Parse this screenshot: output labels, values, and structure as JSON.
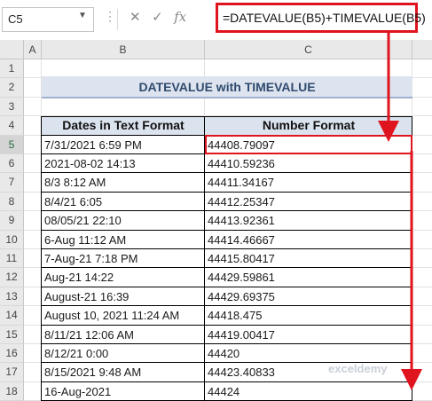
{
  "formula_bar": {
    "name_box": "C5",
    "formula": "=DATEVALUE(B5)+TIMEVALUE(B5)"
  },
  "columns": [
    "A",
    "B",
    "C"
  ],
  "rows": [
    "1",
    "2",
    "3",
    "4",
    "5",
    "6",
    "7",
    "8",
    "9",
    "10",
    "11",
    "12",
    "13",
    "14",
    "15",
    "16",
    "17",
    "18"
  ],
  "sheet": {
    "title": "DATEVALUE with TIMEVALUE",
    "headers": [
      "Dates in Text Format",
      "Number Format"
    ],
    "data": [
      [
        "7/31/2021 6:59 PM",
        "44408.79097"
      ],
      [
        "2021-08-02 14:13",
        "44410.59236"
      ],
      [
        "8/3 8:12 AM",
        "44411.34167"
      ],
      [
        "8/4/21 6:05",
        "44412.25347"
      ],
      [
        "08/05/21 22:10",
        "44413.92361"
      ],
      [
        "6-Aug 11:12 AM",
        "44414.46667"
      ],
      [
        "7-Aug-21 7:18 PM",
        "44415.80417"
      ],
      [
        "Aug-21 14:22",
        "44429.59861"
      ],
      [
        "August-21 16:39",
        "44429.69375"
      ],
      [
        "August 10, 2021 11:24 AM",
        "44418.475"
      ],
      [
        "8/11/21 12:06 AM",
        "44419.00417"
      ],
      [
        "8/12/21 0:00",
        "44420"
      ],
      [
        "8/15/2021 9:48 AM",
        "44423.40833"
      ],
      [
        "16-Aug-2021",
        "44424"
      ]
    ]
  },
  "watermark": "exceldemy",
  "colors": {
    "highlight": "#e0141e",
    "title_bg": "#dde4ef",
    "title_text": "#2f4a6e"
  }
}
